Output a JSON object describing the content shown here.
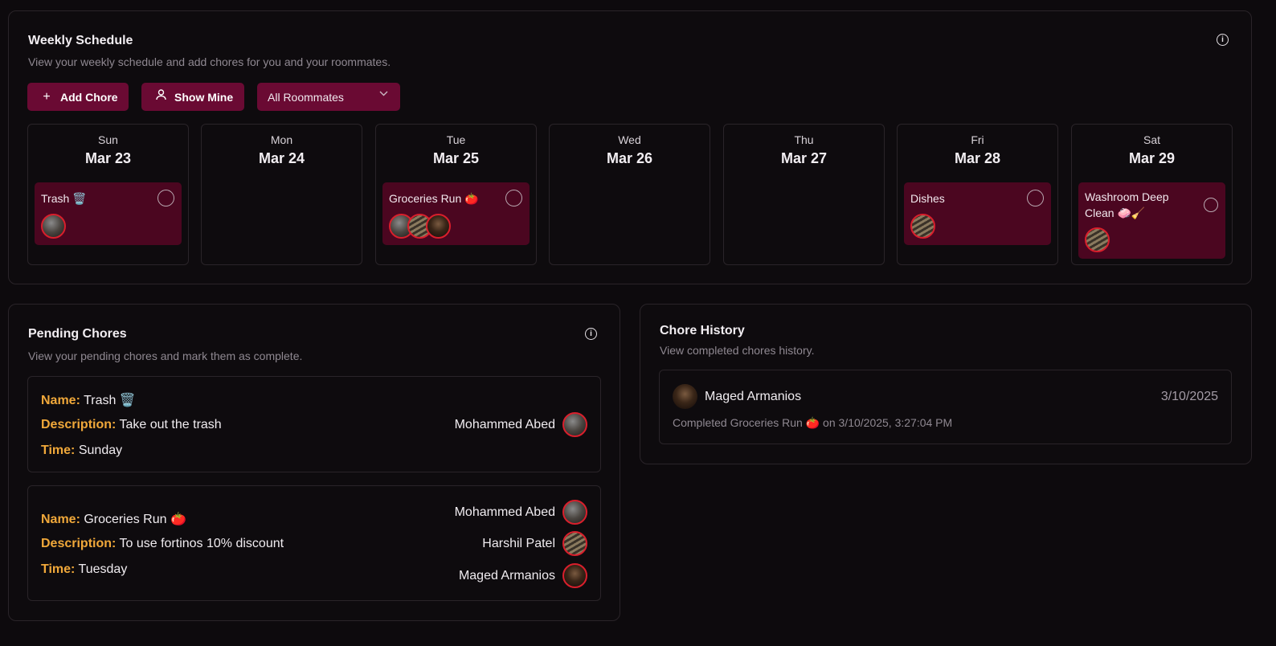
{
  "weekly": {
    "title": "Weekly Schedule",
    "subtitle": "View your weekly schedule and add chores for you and your roommates.",
    "add_chore": "Add Chore",
    "show_mine": "Show Mine",
    "roommate_filter": "All Roommates",
    "days": [
      {
        "name": "Sun",
        "date": "Mar 23",
        "chore": "Trash 🗑️"
      },
      {
        "name": "Mon",
        "date": "Mar 24"
      },
      {
        "name": "Tue",
        "date": "Mar 25",
        "chore": "Groceries Run 🍅"
      },
      {
        "name": "Wed",
        "date": "Mar 26"
      },
      {
        "name": "Thu",
        "date": "Mar 27"
      },
      {
        "name": "Fri",
        "date": "Mar 28",
        "chore": "Dishes"
      },
      {
        "name": "Sat",
        "date": "Mar 29",
        "chore_line1": "Washroom Deep",
        "chore_line2": "Clean 🧼🧹"
      }
    ]
  },
  "pending": {
    "title": "Pending Chores",
    "subtitle": "View your pending chores and mark them as complete.",
    "labels": {
      "name": "Name:",
      "description": "Description:",
      "time": "Time:"
    },
    "items": [
      {
        "name": "Trash 🗑️",
        "description": "Take out the trash",
        "time": "Sunday",
        "assignees": [
          "Mohammed Abed"
        ]
      },
      {
        "name": "Groceries Run 🍅",
        "description": "To use fortinos 10% discount",
        "time": "Tuesday",
        "assignees": [
          "Mohammed Abed",
          "Harshil Patel",
          "Maged Armanios"
        ]
      }
    ]
  },
  "history": {
    "title": "Chore History",
    "subtitle": "View completed chores history.",
    "entries": [
      {
        "user": "Maged Armanios",
        "date": "3/10/2025",
        "detail": "Completed Groceries Run 🍅 on 3/10/2025, 3:27:04 PM"
      }
    ]
  },
  "icons": {
    "info": "info-icon",
    "add": "plus-icon",
    "user": "user-icon",
    "chevron": "chevron-down-icon",
    "check": "circle-check-icon"
  },
  "colors": {
    "background": "#0d0a0d",
    "accent": "#6a0a33",
    "chore_card": "#4b0620",
    "label": "#f0a83a",
    "avatar_ring": "#d91f2c"
  }
}
